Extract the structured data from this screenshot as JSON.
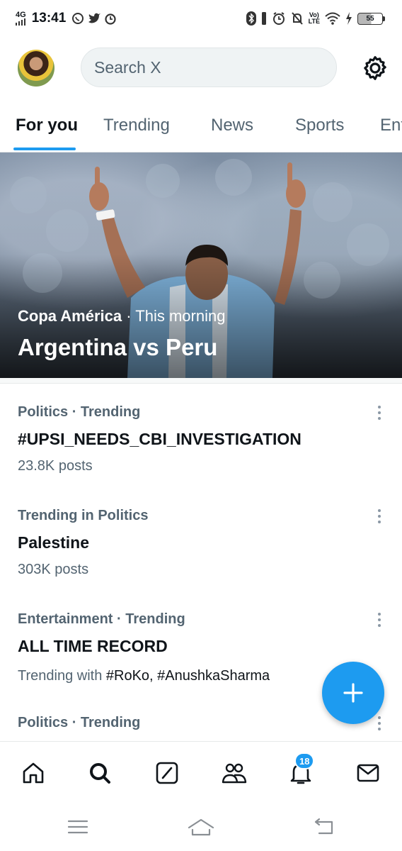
{
  "status_bar": {
    "network": "4G",
    "time": "13:41",
    "volte": "Vo)",
    "lte": "LTE",
    "battery": "55"
  },
  "header": {
    "search_placeholder": "Search X"
  },
  "tabs": [
    {
      "label": "For you",
      "active": true
    },
    {
      "label": "Trending",
      "active": false
    },
    {
      "label": "News",
      "active": false
    },
    {
      "label": "Sports",
      "active": false
    },
    {
      "label": "Ent",
      "active": false
    }
  ],
  "hero": {
    "category": "Copa América",
    "time": "· This morning",
    "title": "Argentina vs Peru"
  },
  "trends": [
    {
      "context": "Politics · Trending",
      "title": "#UPSI_NEEDS_CBI_INVESTIGATION",
      "meta": "23.8K posts"
    },
    {
      "context": "Trending in Politics",
      "title": "Palestine",
      "meta": "303K posts"
    },
    {
      "context": "Entertainment · Trending",
      "title": "ALL TIME RECORD",
      "meta_prefix": "Trending with",
      "meta_tags": "#RoKo, #AnushkaSharma"
    },
    {
      "context": "Politics · Trending"
    }
  ],
  "bottom_nav": {
    "notifications_badge": "18",
    "items": [
      "home-icon",
      "search-icon",
      "grok-icon",
      "communities-icon",
      "notifications-icon",
      "messages-icon"
    ]
  },
  "colors": {
    "accent": "#1d9bf0",
    "secondary_text": "#536471",
    "primary_text": "#0f1419"
  }
}
